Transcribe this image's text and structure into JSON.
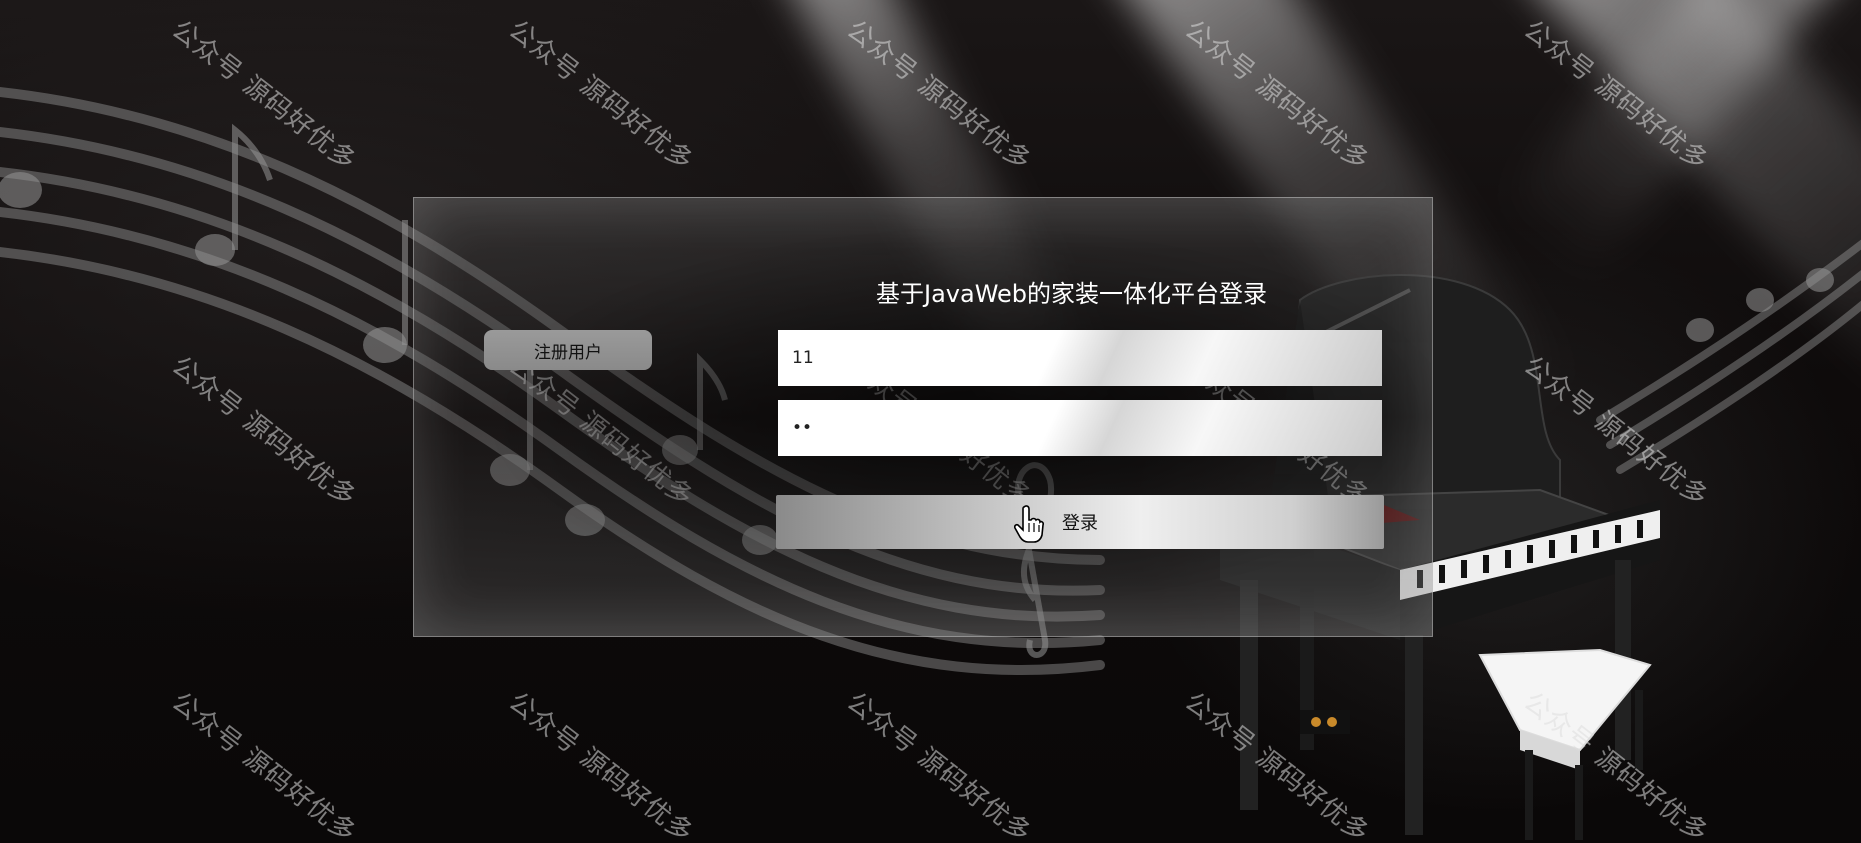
{
  "login": {
    "title": "基于JavaWeb的家装一体化平台登录",
    "register_label": "注册用户",
    "username_value": "11",
    "password_value": "11",
    "login_label": "登录"
  },
  "watermark": {
    "text": "公众号 源码好优多"
  },
  "icons": {
    "cursor": "hand-pointer-icon"
  },
  "colors": {
    "background": "#0d0a0a",
    "panel_border": "#c8c8c8",
    "title_text": "#ffffff"
  }
}
